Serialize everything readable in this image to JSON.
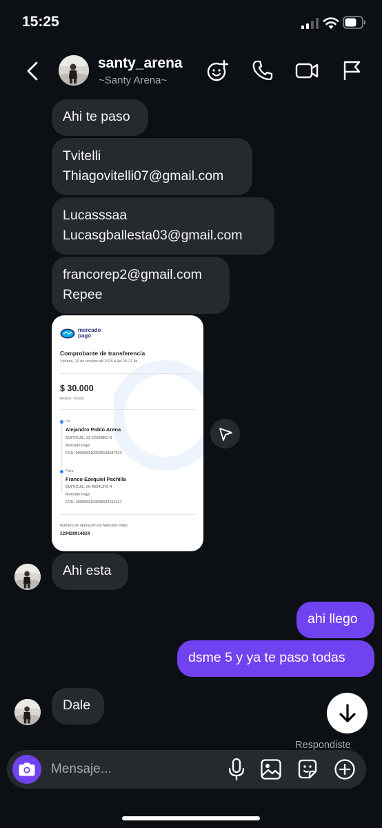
{
  "status_bar": {
    "time": "15:25"
  },
  "header": {
    "username": "santy_arena",
    "display_name": "~Santy Arena~",
    "icons": [
      "back-icon",
      "effects-icon",
      "phone-icon",
      "video-icon",
      "flag-icon"
    ]
  },
  "messages": [
    {
      "direction": "in",
      "lines": [
        "Ahi te paso"
      ]
    },
    {
      "direction": "in",
      "lines": [
        "Tvitelli",
        "Thiagovitelli07@gmail.com"
      ]
    },
    {
      "direction": "in",
      "lines": [
        "Lucasssaa",
        "Lucasgballesta03@gmail.com"
      ]
    },
    {
      "direction": "in",
      "lines": [
        "francorep2@gmail.com",
        "Repee"
      ]
    },
    {
      "direction": "in",
      "lines": [
        "Ahi esta"
      ]
    },
    {
      "direction": "out",
      "lines": [
        "ahi llego"
      ]
    },
    {
      "direction": "out",
      "lines": [
        "dsme 5 y ya te paso todas"
      ]
    },
    {
      "direction": "in",
      "lines": [
        "Dale"
      ]
    }
  ],
  "receipt": {
    "brand_line1": "mercado",
    "brand_line2": "pago",
    "title": "Comprobante de transferencia",
    "date": "Viernes, 10 de octubre de 2025 a las 15:21 hs",
    "amount": "$ 30.000",
    "motivo": "Motivo: Varios",
    "from_label": "De",
    "from_name": "Alejandro Pablo Arena",
    "from_cuit": "CUIT/CUIL: 23-22364802-9",
    "from_bank": "Mercado Pago",
    "from_cvu": "CVU: 0000003100029136647514",
    "to_label": "Para",
    "to_name": "Franco Ezequiel Pachilla",
    "to_cuit": "CUIT/CUIL: 20-46341370-4",
    "to_bank": "Mercado Pago",
    "to_cvu": "CVU: 0000003100095642612117",
    "op_label": "Numero de operación de Mercado Pago",
    "op_number": "129428914624"
  },
  "reply_status": "Respondiste",
  "composer": {
    "placeholder": "Mensaje...",
    "icons": [
      "camera-icon",
      "microphone-icon",
      "gallery-icon",
      "sticker-icon",
      "add-icon"
    ]
  },
  "colors": {
    "background": "#0c1014",
    "incoming_bubble": "#262a2f",
    "outgoing_bubble": "#7142f0",
    "secondary_text": "#a8a8a8"
  }
}
